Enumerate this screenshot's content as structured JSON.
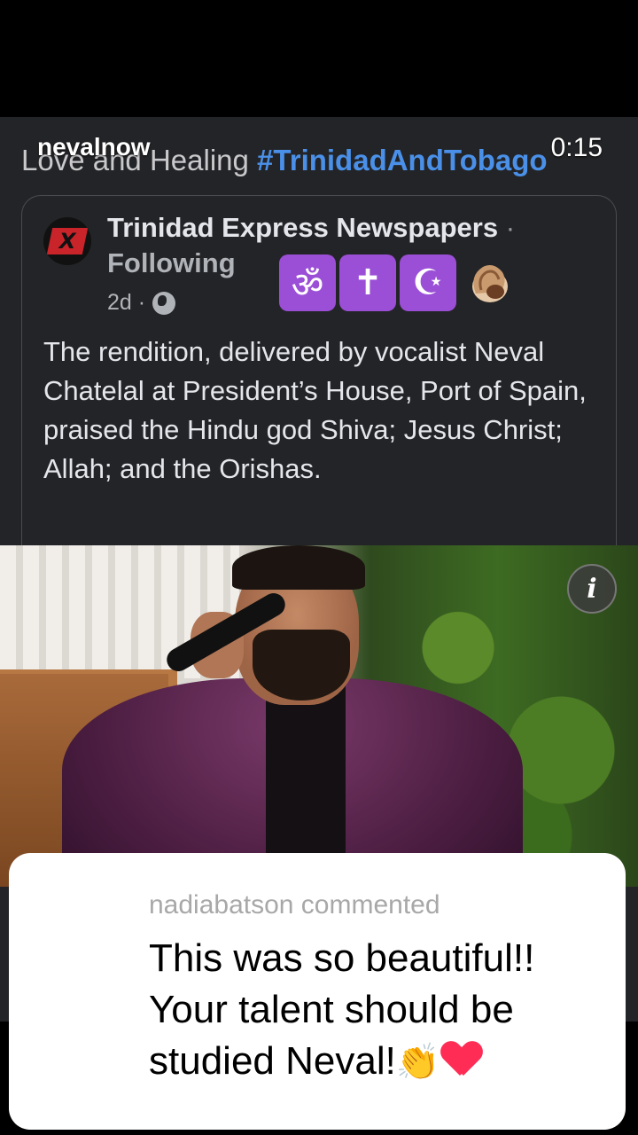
{
  "overlay": {
    "username": "nevalnow",
    "timestamp": "0:15"
  },
  "post": {
    "caption_prefix": "Love and Healing ",
    "caption_hashtag": "#TrinidadAndTobago",
    "page_name": "Trinidad Express Newspapers",
    "separator": " ·",
    "follow_status": "Following",
    "age": "2d ·",
    "logo_letter": "X",
    "emojis": [
      "ॐ",
      "✝",
      "☪"
    ],
    "body": "The rendition, delivered by vocalist Neval Chatelal at President’s House, Port of Spain, praised the Hindu god Shiva; Jesus Christ; Allah; and the Orishas."
  },
  "info_button": {
    "glyph": "i"
  },
  "comment": {
    "author_line": "nadiabatson commented",
    "text": "This was so beautiful!! Your talent should be studied Neval!",
    "clap_emoji": "👏"
  },
  "icons": [
    "globe-icon",
    "info-icon",
    "clap-emoji",
    "heart-emoji",
    "shell-emoji"
  ],
  "colors": {
    "hashtag": "#4a90e8",
    "card_background": "#232427",
    "emoji_box": "#9b4fd6",
    "heart": "#ff2d55"
  }
}
